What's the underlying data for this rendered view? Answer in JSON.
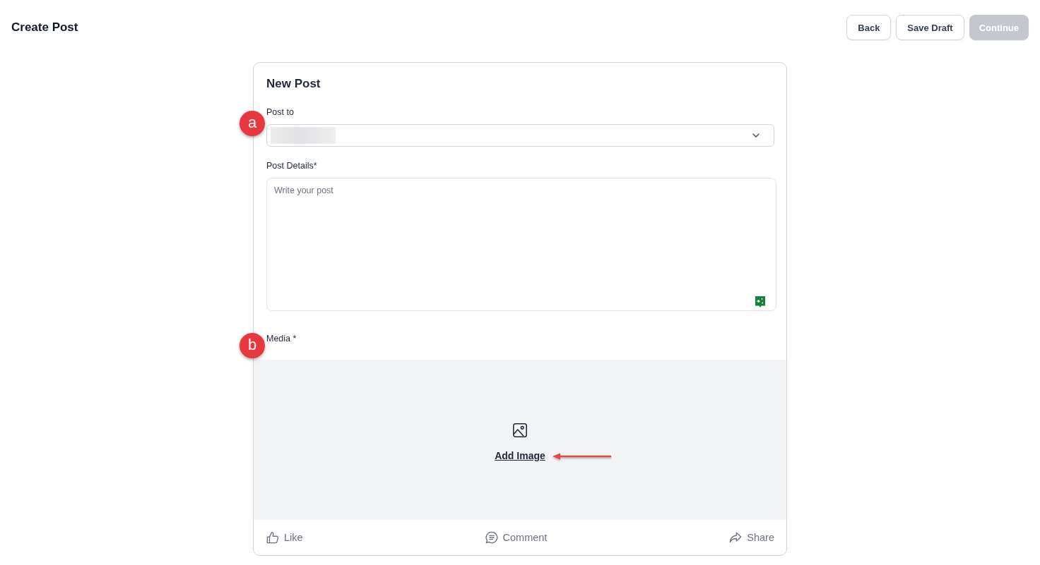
{
  "header": {
    "title": "Create Post"
  },
  "actions": [
    {
      "label": "Back",
      "disabled": false
    },
    {
      "label": "Save Draft",
      "disabled": false
    },
    {
      "label": "Continue",
      "disabled": true
    }
  ],
  "card": {
    "title": "New Post",
    "post_to": {
      "label": "Post to"
    },
    "post_details": {
      "label": "Post Details*",
      "placeholder": "Write your post"
    },
    "media": {
      "label": "Media *",
      "add_link": "Add Image"
    },
    "reactions": [
      {
        "kind": "like",
        "label": "Like"
      },
      {
        "kind": "comment",
        "label": "Comment"
      },
      {
        "kind": "share",
        "label": "Share"
      }
    ]
  },
  "annotations": [
    {
      "label": "a"
    },
    {
      "label": "b"
    }
  ]
}
